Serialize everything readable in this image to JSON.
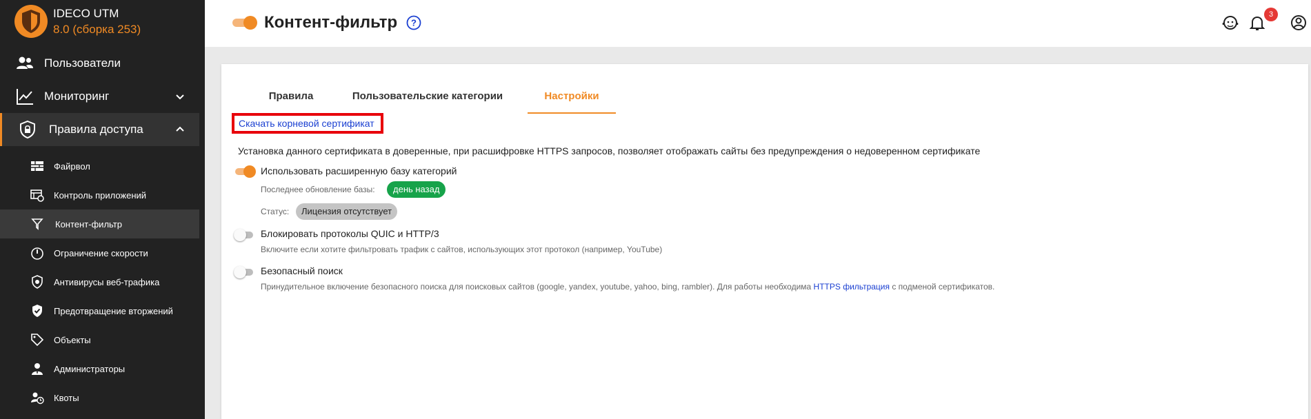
{
  "brand": {
    "name": "IDECO UTM",
    "version": "8.0 (сборка 253)"
  },
  "sidebar": {
    "items": [
      {
        "label": "Пользователи",
        "icon": "users-icon"
      },
      {
        "label": "Мониторинг",
        "icon": "chart-line-icon"
      },
      {
        "label": "Правила доступа",
        "icon": "shield-lock-icon"
      }
    ],
    "subitems": [
      {
        "label": "Файрвол",
        "icon": "firewall-icon"
      },
      {
        "label": "Контроль приложений",
        "icon": "app-control-icon"
      },
      {
        "label": "Контент-фильтр",
        "icon": "filter-icon"
      },
      {
        "label": "Ограничение скорости",
        "icon": "speed-limit-icon"
      },
      {
        "label": "Антивирусы веб-трафика",
        "icon": "antivirus-shield-icon"
      },
      {
        "label": "Предотвращение вторжений",
        "icon": "ips-shield-icon"
      },
      {
        "label": "Объекты",
        "icon": "tag-icon"
      },
      {
        "label": "Администраторы",
        "icon": "admin-icon"
      },
      {
        "label": "Квоты",
        "icon": "quota-icon"
      }
    ]
  },
  "header": {
    "title": "Контент-фильтр",
    "notifications_count": "3"
  },
  "tabs": [
    {
      "label": "Правила"
    },
    {
      "label": "Пользовательские категории"
    },
    {
      "label": "Настройки"
    }
  ],
  "settings": {
    "cert_link": "Скачать корневой сертификат",
    "cert_description": "Установка данного сертификата в доверенные, при расшифровке HTTPS запросов, позволяет отображать сайты без предупреждения о недоверенном сертификате",
    "extended_db": {
      "label": "Использовать расширенную базу категорий",
      "last_update_label": "Последнее обновление базы:",
      "last_update_value": "день назад",
      "status_label": "Статус:",
      "status_value": "Лицензия отсутствует"
    },
    "quic": {
      "label": "Блокировать протоколы QUIC и HTTP/3",
      "hint": "Включите если хотите фильтровать трафик с сайтов, использующих этот протокол (например, YouTube)"
    },
    "safe_search": {
      "label": "Безопасный поиск",
      "hint_before": "Принудительное включение безопасного поиска для поисковых сайтов (google, yandex, youtube, yahoo, bing, rambler). Для работы необходима ",
      "hint_link": "HTTPS фильтрация",
      "hint_after": " с подменой сертификатов."
    }
  },
  "colors": {
    "accent": "#f08a24",
    "sidebar_bg": "#222222",
    "link": "#1a3fd1",
    "highlight": "#e8000b",
    "success": "#17a34a"
  }
}
